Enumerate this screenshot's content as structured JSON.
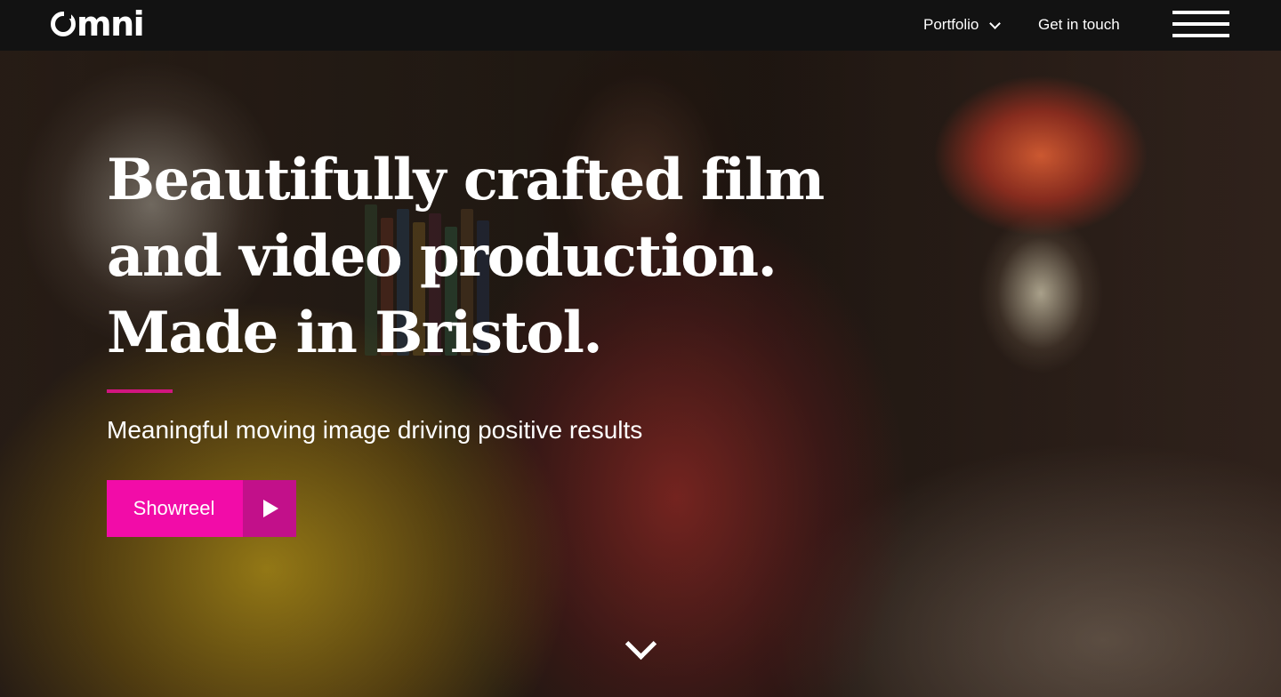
{
  "brand": {
    "logo_text": "mni",
    "accent_color": "#f20ca8",
    "accent_dark": "#c2108a",
    "rule_color": "#d1157f"
  },
  "nav": {
    "portfolio_label": "Portfolio",
    "contact_label": "Get in touch",
    "menu_icon": "hamburger-icon"
  },
  "hero": {
    "headline": "Beautifully crafted film and video production. Made in Bristol.",
    "subheadline": "Meaningful moving image driving positive results",
    "cta_label": "Showreel",
    "cta_icon": "play-icon",
    "scroll_icon": "chevron-down-icon"
  }
}
